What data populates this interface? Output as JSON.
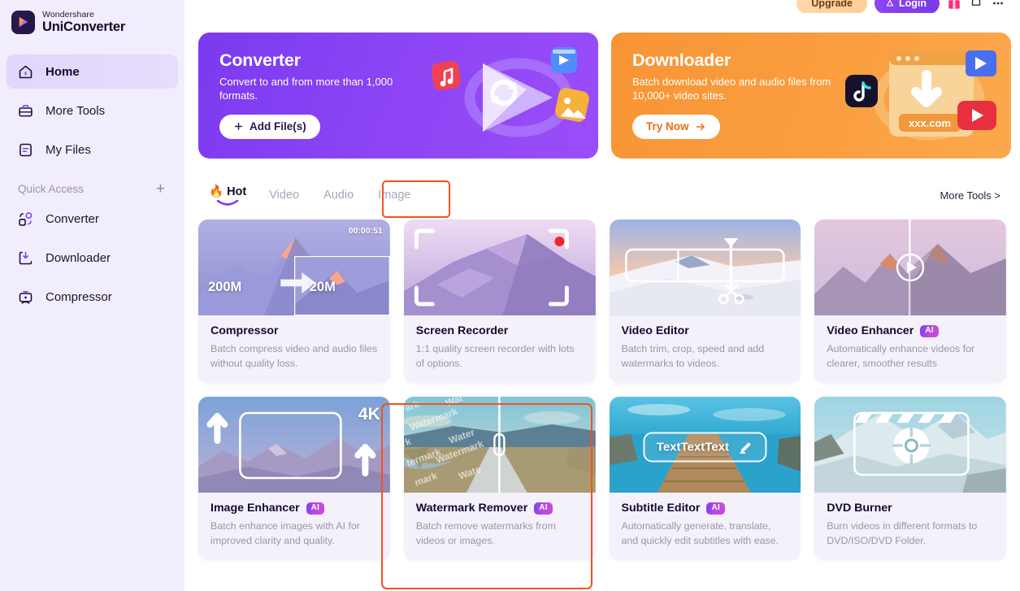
{
  "brand": {
    "top": "Wondershare",
    "bottom": "UniConverter",
    "logo_icon": "uniconverter-logo-icon"
  },
  "sidebar": {
    "nav": [
      {
        "label": "Home",
        "icon": "home-icon",
        "active": true
      },
      {
        "label": "More Tools",
        "icon": "toolbox-icon",
        "active": false
      },
      {
        "label": "My Files",
        "icon": "files-icon",
        "active": false
      }
    ],
    "quick_access": {
      "title": "Quick Access",
      "add_icon": "plus-icon"
    },
    "quick_items": [
      {
        "label": "Converter",
        "icon": "converter-icon"
      },
      {
        "label": "Downloader",
        "icon": "downloader-icon"
      },
      {
        "label": "Compressor",
        "icon": "compressor-icon"
      }
    ]
  },
  "topbar": {
    "upgrade_label": "Upgrade",
    "login_label": "Login",
    "login_icon": "person-icon",
    "gift_icon": "gift-icon",
    "notification_icon": "bell-icon",
    "menu_icon": "more-menu-icon"
  },
  "banners": [
    {
      "title": "Converter",
      "desc": "Convert to and from more than 1,000 formats.",
      "button": "Add File(s)",
      "button_icon": "plus-icon",
      "color": "#8b45f5",
      "art_icon": "convert-arrows-art"
    },
    {
      "title": "Downloader",
      "desc": "Batch download video and audio files from 10,000+ video sites.",
      "button": "Try Now",
      "button_icon": "arrow-right-icon",
      "color": "#f99a3c",
      "art_icon": "download-browser-art",
      "art_label": "xxx.com"
    }
  ],
  "tabs": {
    "items": [
      {
        "label": "Hot",
        "icon": "flame-icon",
        "active": true
      },
      {
        "label": "Video",
        "active": false
      },
      {
        "label": "Audio",
        "active": false
      },
      {
        "label": "Image",
        "active": false
      }
    ],
    "more_tools_label": "More Tools >"
  },
  "cards": [
    {
      "title": "Compressor",
      "desc": "Batch compress video and audio files without quality loss.",
      "ai": false,
      "thumb": {
        "kind": "compressor",
        "timestamp": "00:00:51",
        "from": "200M",
        "to": "20M"
      }
    },
    {
      "title": "Screen Recorder",
      "desc": "1:1 quality screen recorder with lots of options.",
      "ai": false,
      "thumb": {
        "kind": "recorder"
      }
    },
    {
      "title": "Video Editor",
      "desc": "Batch trim, crop, speed and add watermarks to videos.",
      "ai": false,
      "thumb": {
        "kind": "editor"
      }
    },
    {
      "title": "Video Enhancer",
      "desc": "Automatically enhance videos for clearer, smoother results",
      "ai": true,
      "ai_label": "AI",
      "thumb": {
        "kind": "enhancer-video"
      }
    },
    {
      "title": "Image Enhancer",
      "desc": "Batch enhance images with AI for improved clarity and quality.",
      "ai": true,
      "ai_label": "AI",
      "highlighted": true,
      "thumb": {
        "kind": "image-enhancer",
        "badge_4k": "4K"
      }
    },
    {
      "title": "Watermark Remover",
      "desc": "Batch remove watermarks from videos or images.",
      "ai": true,
      "ai_label": "AI",
      "thumb": {
        "kind": "watermark",
        "watermark_text": "Watermark"
      }
    },
    {
      "title": "Subtitle Editor",
      "desc": "Automatically generate, translate, and quickly edit subtitles with ease.",
      "ai": true,
      "ai_label": "AI",
      "thumb": {
        "kind": "subtitle",
        "pill_text": "TextTextText",
        "pill_icon": "pencil-icon"
      }
    },
    {
      "title": "DVD Burner",
      "desc": "Burn videos in different formats to DVD/ISO/DVD Folder.",
      "ai": false,
      "thumb": {
        "kind": "dvd"
      }
    }
  ],
  "colors": {
    "accent_purple": "#8b45f5",
    "accent_orange": "#f99a3c",
    "highlight_red": "#f4501e",
    "sidebar_bg": "#f2edfc",
    "card_bg": "#f4f1fb"
  }
}
